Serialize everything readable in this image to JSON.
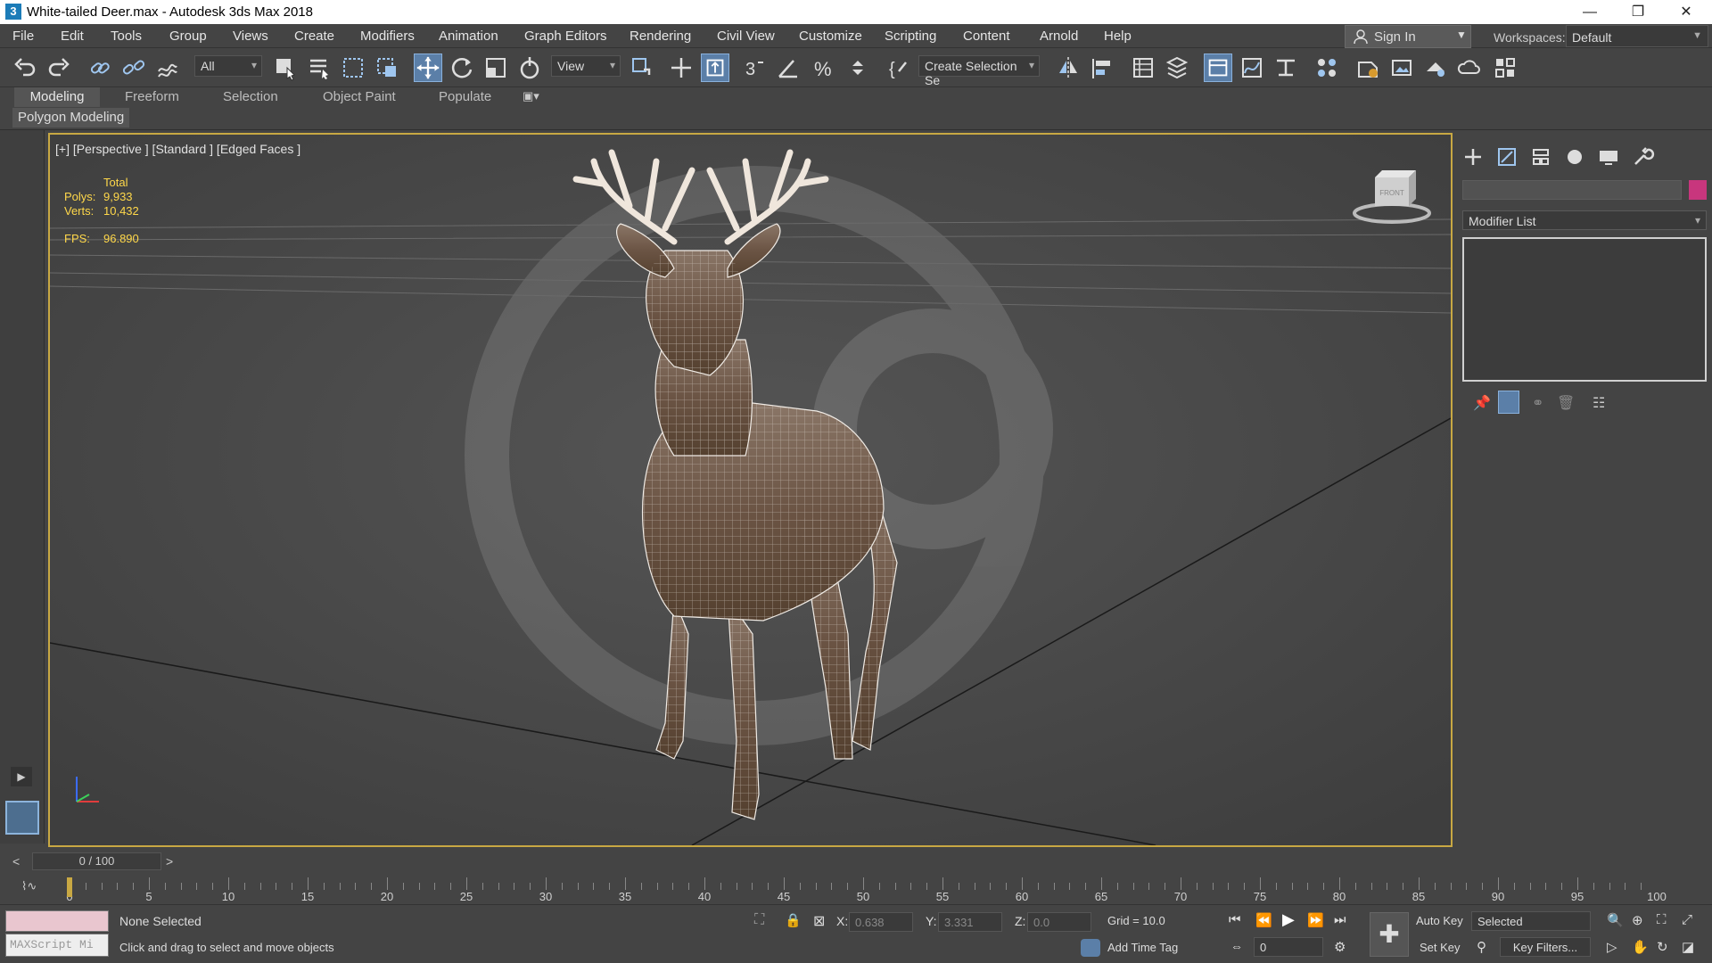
{
  "window": {
    "title": "White-tailed Deer.max - Autodesk 3ds Max 2018",
    "app_icon": "3",
    "controls": {
      "minimize": "—",
      "restore": "❐",
      "close": "✕"
    }
  },
  "menubar": {
    "items": [
      "File",
      "Edit",
      "Tools",
      "Group",
      "Views",
      "Create",
      "Modifiers",
      "Animation",
      "Graph Editors",
      "Rendering",
      "Civil View",
      "Customize",
      "Scripting",
      "Content",
      "Arnold",
      "Help"
    ],
    "sign_in": "Sign In",
    "workspaces_label": "Workspaces:",
    "workspace_value": "Default"
  },
  "toolbar": {
    "selection_filter": "All",
    "reference_coord": "View",
    "named_selection": "Create Selection Se"
  },
  "ribbon": {
    "tabs": [
      "Modeling",
      "Freeform",
      "Selection",
      "Object Paint",
      "Populate"
    ],
    "active_tab": "Modeling",
    "sub_label": "Polygon Modeling"
  },
  "viewport": {
    "label": "[+] [Perspective ] [Standard ] [Edged Faces ]",
    "stats": {
      "total_label": "Total",
      "polys_label": "Polys:",
      "polys_value": "9,933",
      "verts_label": "Verts:",
      "verts_value": "10,432",
      "fps_label": "FPS:",
      "fps_value": "96.890"
    },
    "viewcube_face": "FRONT"
  },
  "command_panel": {
    "modifier_list": "Modifier List",
    "object_color": "#c8367d"
  },
  "timeline": {
    "frame_display": "0 / 100",
    "prev": "<",
    "next": ">",
    "ticks": [
      "0",
      "5",
      "10",
      "15",
      "20",
      "25",
      "30",
      "35",
      "40",
      "45",
      "50",
      "55",
      "60",
      "65",
      "70",
      "75",
      "80",
      "85",
      "90",
      "95",
      "100"
    ]
  },
  "status": {
    "maxscript_placeholder": "MAXScript Mi",
    "selection": "None Selected",
    "prompt": "Click and drag to select and move objects",
    "x_label": "X:",
    "x_value": "0.638",
    "y_label": "Y:",
    "y_value": "3.331",
    "z_label": "Z:",
    "z_value": "0.0",
    "grid": "Grid = 10.0",
    "add_time_tag": "Add Time Tag",
    "auto_key": "Auto Key",
    "set_key": "Set Key",
    "key_mode": "Selected",
    "key_filters": "Key Filters...",
    "current_frame": "0"
  }
}
